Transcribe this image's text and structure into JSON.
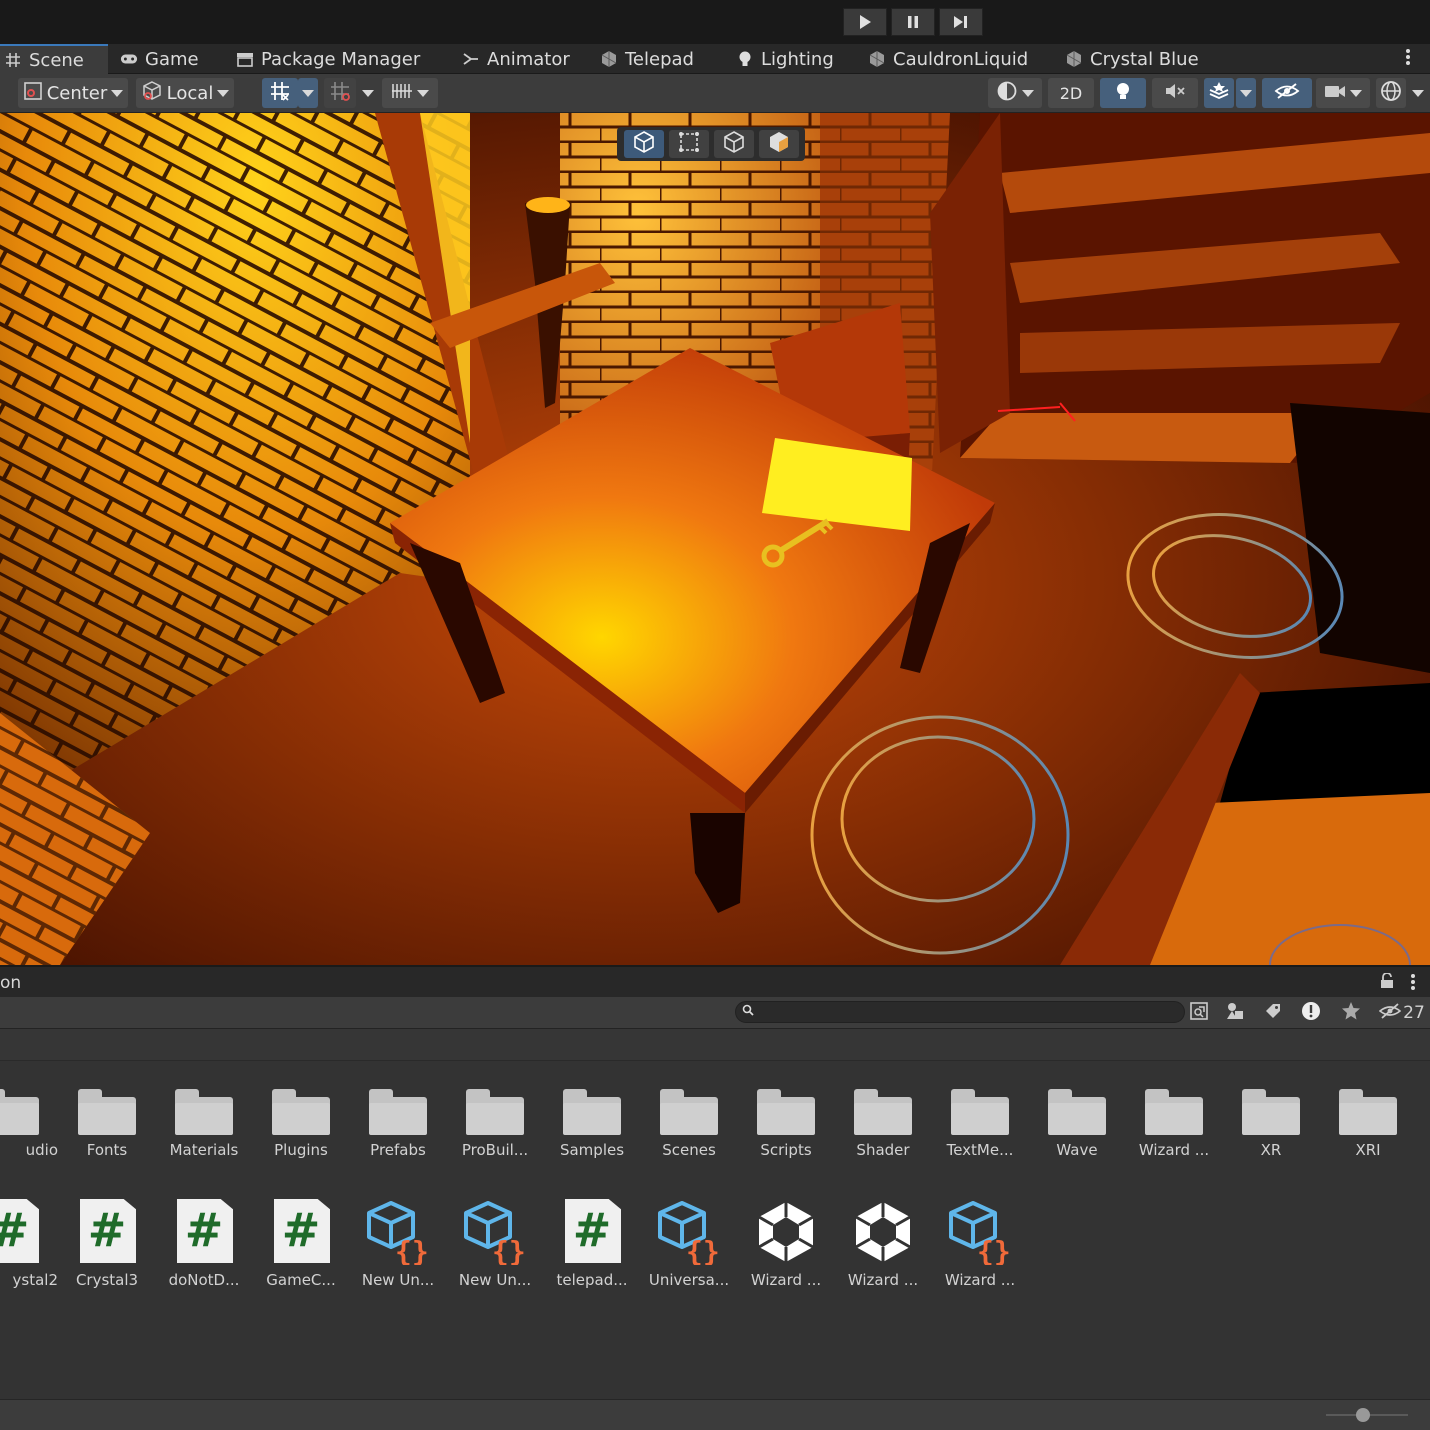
{
  "playbar": {
    "buttons": [
      {
        "name": "play-button",
        "icon": "play-icon"
      },
      {
        "name": "pause-button",
        "icon": "pause-icon"
      },
      {
        "name": "step-button",
        "icon": "step-icon"
      }
    ]
  },
  "tabs": [
    {
      "label": "Scene",
      "icon": "grid-icon",
      "active": true
    },
    {
      "label": "Game",
      "icon": "gamepad-icon"
    },
    {
      "label": "Package Manager",
      "icon": "package-icon"
    },
    {
      "label": "Animator",
      "icon": "animator-icon"
    },
    {
      "label": "Telepad",
      "icon": "prefab-icon"
    },
    {
      "label": "Lighting",
      "icon": "bulb-icon"
    },
    {
      "label": "CauldronLiquid",
      "icon": "prefab-icon"
    },
    {
      "label": "Crystal Blue",
      "icon": "prefab-icon"
    }
  ],
  "toolbar": {
    "pivot_label": "Center",
    "space_label": "Local",
    "mode_2d_label": "2D"
  },
  "project": {
    "title": "on",
    "search_placeholder": "",
    "hidden_count": "27",
    "folders": [
      "udio",
      "Fonts",
      "Materials",
      "Plugins",
      "Prefabs",
      "ProBuil...",
      "Samples",
      "Scenes",
      "Scripts",
      "Shader",
      "TextMe...",
      "Wave",
      "Wizard ...",
      "XR",
      "XRI"
    ],
    "files": [
      {
        "label": "ystal2",
        "kind": "script"
      },
      {
        "label": "Crystal3",
        "kind": "script"
      },
      {
        "label": "doNotD...",
        "kind": "script"
      },
      {
        "label": "GameC...",
        "kind": "script"
      },
      {
        "label": "New Un...",
        "kind": "asmdef"
      },
      {
        "label": "New Un...",
        "kind": "asmdef"
      },
      {
        "label": "telepad...",
        "kind": "script"
      },
      {
        "label": "Universa...",
        "kind": "asmdef"
      },
      {
        "label": "Wizard ...",
        "kind": "unity"
      },
      {
        "label": "Wizard ...",
        "kind": "unity"
      },
      {
        "label": "Wizard ...",
        "kind": "asmdef"
      }
    ]
  },
  "colors": {
    "accent": "#3a79bb",
    "script_hash": "#1f6b2a",
    "asmdef_cube": "#5fb6ea",
    "asmdef_braces": "#f06a3a"
  }
}
